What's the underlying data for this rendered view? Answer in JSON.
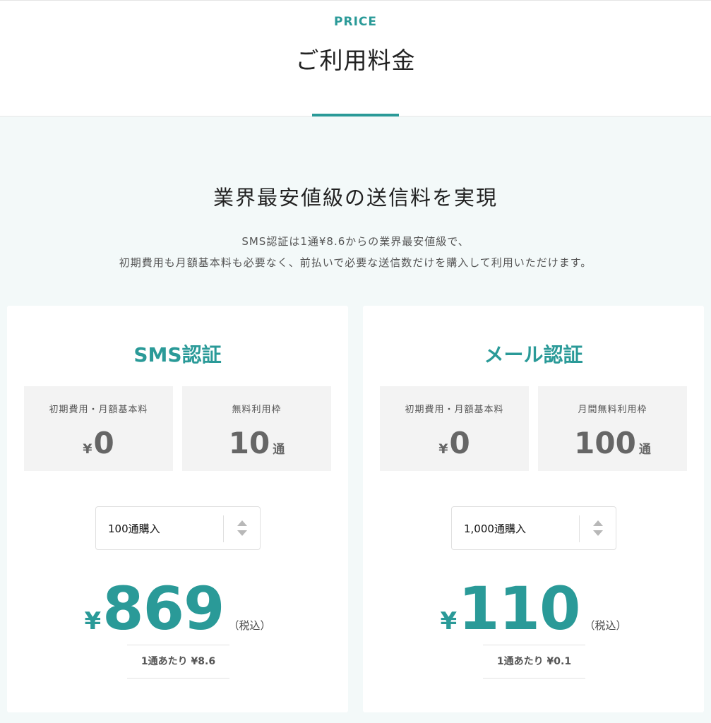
{
  "header": {
    "eyebrow": "PRICE",
    "title": "ご利用料金"
  },
  "intro": {
    "headline": "業界最安値級の送信料を実現",
    "line1": "SMS認証は1通¥8.6からの業界最安値級で、",
    "line2": "初期費用も月額基本料も必要なく、前払いで必要な送信数だけを購入して利用いただけます。"
  },
  "plans": [
    {
      "title": "SMS認証",
      "fee": {
        "label": "初期費用・月額基本料",
        "currency": "¥",
        "value": "0"
      },
      "free": {
        "label": "無料利用枠",
        "value": "10",
        "unit": "通"
      },
      "select": {
        "value": "100通購入"
      },
      "price": {
        "currency": "¥",
        "amount": "869",
        "tax": "（税込）"
      },
      "per_unit": "1通あたり ¥8.6"
    },
    {
      "title": "メール認証",
      "fee": {
        "label": "初期費用・月額基本料",
        "currency": "¥",
        "value": "0"
      },
      "free": {
        "label": "月間無料利用枠",
        "value": "100",
        "unit": "通"
      },
      "select": {
        "value": "1,000通購入"
      },
      "price": {
        "currency": "¥",
        "amount": "110",
        "tax": "（税込）"
      },
      "per_unit": "1通あたり ¥0.1"
    }
  ],
  "colors": {
    "accent": "#2a9a98",
    "section_bg": "#f3f9f9",
    "box_bg": "#f3f3f3"
  }
}
